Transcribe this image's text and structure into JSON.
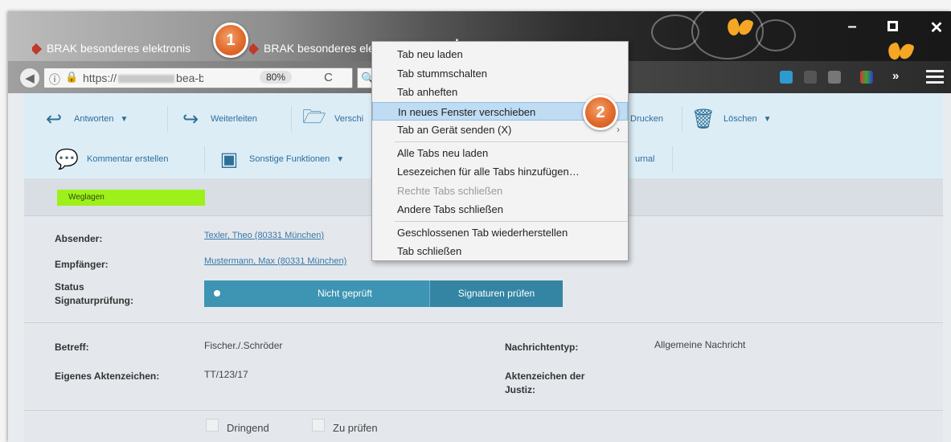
{
  "browser": {
    "tabs": [
      {
        "label": "BRAK besonderes elektronis"
      },
      {
        "label": "BRAK besonderes elekt"
      }
    ],
    "new_tab": "+",
    "tab_close": "×",
    "window_controls": {
      "minimize": "–",
      "close": "✕"
    },
    "url_prefix": "https://",
    "url_domain": "bea-br",
    "zoom": "80%",
    "reload": "C",
    "search_icon": "search-icon",
    "overflow": "»"
  },
  "toolbar": {
    "row1": [
      {
        "label": "Antworten",
        "icon": "reply-icon",
        "dropdown": true
      },
      {
        "label": "Weiterleiten",
        "icon": "forward-icon",
        "dropdown": false
      },
      {
        "label": "Verschi",
        "icon": "folder-icon",
        "dropdown": false
      },
      {
        "label": "Drucken",
        "icon": "print-icon",
        "dropdown": false
      },
      {
        "label": "Löschen",
        "icon": "trash-icon",
        "dropdown": true
      }
    ],
    "row2": [
      {
        "label": "Kommentar erstellen",
        "icon": "comment-icon",
        "dropdown": false
      },
      {
        "label": "Sonstige Funktionen",
        "icon": "dropdown-box-icon",
        "dropdown": true
      },
      {
        "label": "urnal",
        "icon": "",
        "dropdown": false
      }
    ]
  },
  "status": {
    "tag": "Weglagen"
  },
  "message": {
    "sender_label": "Absender:",
    "sender": "Texler, Theo (80331 München)",
    "recipient_label": "Empfänger:",
    "recipient": "Mustermann, Max (80331 München)",
    "sigstatus_label_1": "Status",
    "sigstatus_label_2": "Signaturprüfung:",
    "sig_not_checked": "Nicht geprüft",
    "sig_check_button": "Signaturen prüfen",
    "subject_label": "Betreff:",
    "subject": "Fischer./.Schröder",
    "msgtype_label": "Nachrichtentyp:",
    "msgtype": "Allgemeine Nachricht",
    "ref_label": "Eigenes Aktenzeichen:",
    "ref": "TT/123/17",
    "court_ref_label_1": "Aktenzeichen der",
    "court_ref_label_2": "Justiz:",
    "urgent": "Dringend",
    "to_check": "Zu prüfen"
  },
  "context_menu": {
    "items": [
      {
        "label": "Tab neu laden",
        "highlight": false,
        "disabled": false
      },
      {
        "label": "Tab stummschalten",
        "highlight": false,
        "disabled": false
      },
      {
        "label": "Tab anheften",
        "highlight": false,
        "disabled": false
      },
      {
        "label": "In neues Fenster verschieben",
        "highlight": true,
        "disabled": false
      },
      {
        "label": "Tab an Gerät senden (X)",
        "highlight": false,
        "disabled": false,
        "submenu": "›"
      },
      {
        "label": "Alle Tabs neu laden",
        "highlight": false,
        "disabled": false
      },
      {
        "label": "Lesezeichen für alle Tabs hinzufügen…",
        "highlight": false,
        "disabled": false
      },
      {
        "label": "Rechte Tabs schließen",
        "highlight": false,
        "disabled": true
      },
      {
        "label": "Andere Tabs schließen",
        "highlight": false,
        "disabled": false
      },
      {
        "label": "Geschlossenen Tab wiederherstellen",
        "highlight": false,
        "disabled": false
      },
      {
        "label": "Tab schließen",
        "highlight": false,
        "disabled": false
      }
    ]
  },
  "markers": {
    "m1": "1",
    "m2": "2"
  },
  "colors": {
    "accent": "#3d94b3",
    "status_tag": "#9ef01a",
    "toolbar_bg": "#dcedf6",
    "menu_highlight": "#bfdcf3",
    "marker": "#e26a2c"
  }
}
